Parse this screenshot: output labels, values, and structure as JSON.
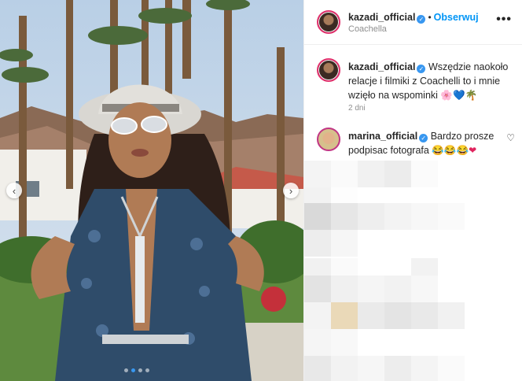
{
  "post": {
    "author": "kazadi_official",
    "verified_badge": "✓",
    "separator": "•",
    "follow_label": "Obserwuj",
    "location": "Coachella",
    "more_icon": "•••",
    "nav_prev": "‹",
    "nav_next": "›",
    "carousel_dots": 4,
    "carousel_active": 1
  },
  "caption": {
    "author": "kazadi_official",
    "text": "Wszędzie naokoło relacje i filmiki z Coachelli to i mnie wzięło na wspominki",
    "emojis": [
      "🌸",
      "💙",
      "🌴"
    ],
    "time": "2 dni"
  },
  "comment": {
    "author": "marina_official",
    "text": "Bardzo prosze podpisac fotografa",
    "emojis": [
      "😂",
      "😂",
      "😂",
      "❤"
    ],
    "like_icon": "♡"
  },
  "colors": {
    "accent": "#0095f6",
    "verified": "#3897f0",
    "text": "#262626",
    "muted": "#8e8e8e"
  }
}
